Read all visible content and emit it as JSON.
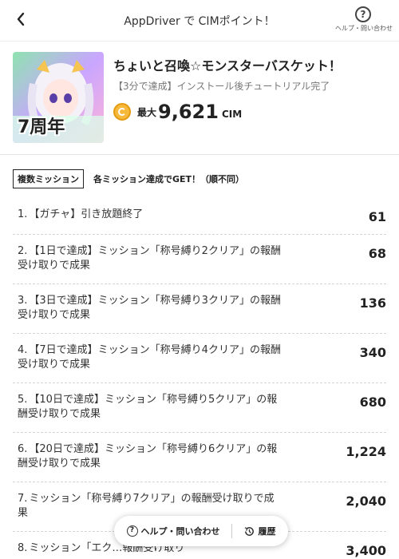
{
  "header": {
    "title": "AppDriver で CIMポイント！",
    "help_label": "ヘルプ・問い合わせ",
    "help_symbol": "?"
  },
  "app": {
    "thumb_text": "7周年",
    "name": "ちょいと召喚☆モンスターバスケット！",
    "subtitle": "【3分で達成】インストール後チュートリアル完了",
    "max_label": "最大",
    "points": "9,621",
    "unit": "CIM"
  },
  "missions": {
    "badge": "複数ミッション",
    "note": "各ミッション達成でGET！（順不同）",
    "items": [
      {
        "num": "1.",
        "text": "【ガチャ】引き放題終了",
        "points": "61"
      },
      {
        "num": "2.",
        "text": "【1日で達成】ミッション「称号縛り2クリア」の報酬受け取りで成果",
        "points": "68"
      },
      {
        "num": "3.",
        "text": "【3日で達成】ミッション「称号縛り3クリア」の報酬受け取りで成果",
        "points": "136"
      },
      {
        "num": "4.",
        "text": "【7日で達成】ミッション「称号縛り4クリア」の報酬受け取りで成果",
        "points": "340"
      },
      {
        "num": "5.",
        "text": "【10日で達成】ミッション「称号縛り5クリア」の報酬受け取りで成果",
        "points": "680"
      },
      {
        "num": "6.",
        "text": "【20日で達成】ミッション「称号縛り6クリア」の報酬受け取りで成果",
        "points": "1,224"
      },
      {
        "num": "7.",
        "text": "ミッション「称号縛り7クリア」の報酬受け取りで成果",
        "points": "2,040"
      },
      {
        "num": "8.",
        "text": "ミッション「エク…報酬受け取り",
        "points": "3,400"
      }
    ]
  },
  "floating_bar": {
    "help_label": "ヘルプ・問い合わせ",
    "history_label": "履歴"
  },
  "colors": {
    "coin": "#f6b93b",
    "coin_border": "#e69a10"
  }
}
